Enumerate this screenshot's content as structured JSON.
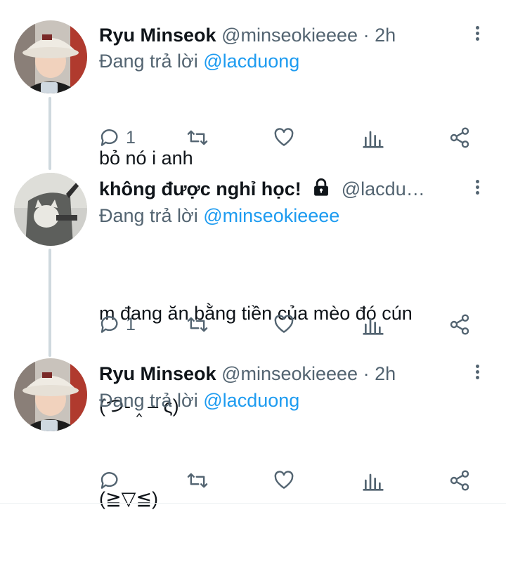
{
  "tweets": [
    {
      "name": "Ryu Minseok",
      "handle": "@minseokieeee",
      "time": "· 2h",
      "reply_prefix": "Đang trả lời ",
      "reply_to": "@lacduong",
      "text_lines": [
        "bỏ nó i anh"
      ],
      "reply_count": "1",
      "avatar": "person-bucket-hat-avatar"
    },
    {
      "name": "không được nghỉ học!",
      "handle": "@lacdu…",
      "time": "",
      "reply_prefix": "Đang trả lời ",
      "reply_to": "@minseokieeee",
      "text_lines": [
        "m đang ăn bằng tiền của mèo đó cún",
        "(つ- ‸ – ς)"
      ],
      "reply_count": "1",
      "avatar": "cat-photo-avatar",
      "lock_icon": "lock-icon"
    },
    {
      "name": "Ryu Minseok",
      "handle": "@minseokieeee",
      "time": "· 2h",
      "reply_prefix": "Đang trả lời ",
      "reply_to": "@lacduong",
      "text_lines": [
        "(≧▽≦)"
      ],
      "reply_count": "",
      "avatar": "person-bucket-hat-avatar"
    }
  ],
  "colors": {
    "link": "#1d9bf0",
    "secondary": "#536471",
    "thread_line": "#cfd9de"
  }
}
